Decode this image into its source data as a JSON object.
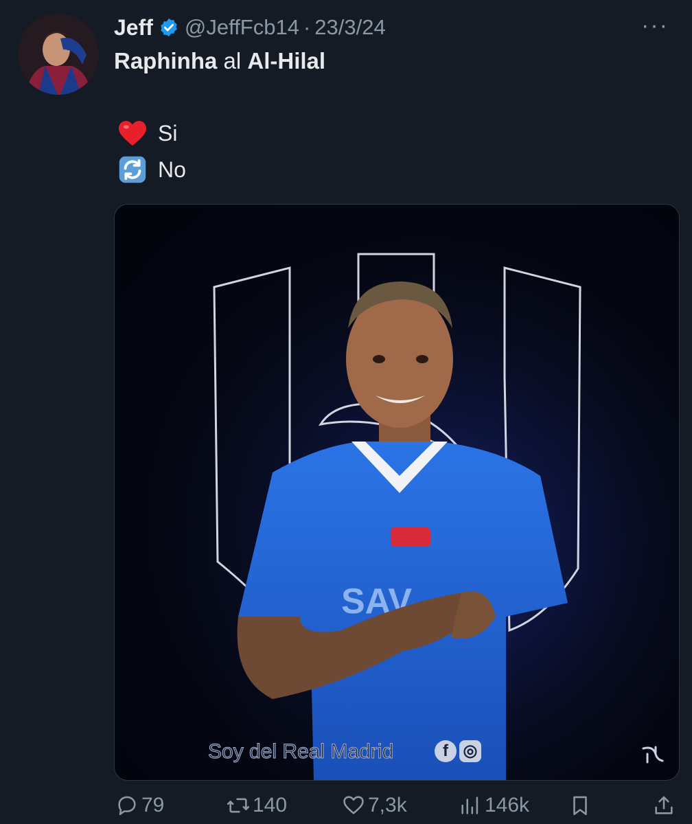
{
  "tweet": {
    "author_name": "Jeff",
    "handle": "@JeffFcb14",
    "separator": "·",
    "date": "23/3/24",
    "more_label": "···",
    "text_a": "Raphinha",
    "text_b": " al ",
    "text_c": "Al-Hilal",
    "options": [
      {
        "icon": "heart-icon",
        "label": "Si"
      },
      {
        "icon": "repost-icon",
        "label": "No"
      }
    ],
    "image_watermark": "Soy del Real Madrid"
  },
  "actions": {
    "replies": "79",
    "reposts": "140",
    "likes": "7,3k",
    "views": "146k"
  },
  "colors": {
    "background": "#151b24",
    "verified": "#1d9bf0",
    "muted": "#8b98a5",
    "jersey": "#1f5fd0"
  }
}
